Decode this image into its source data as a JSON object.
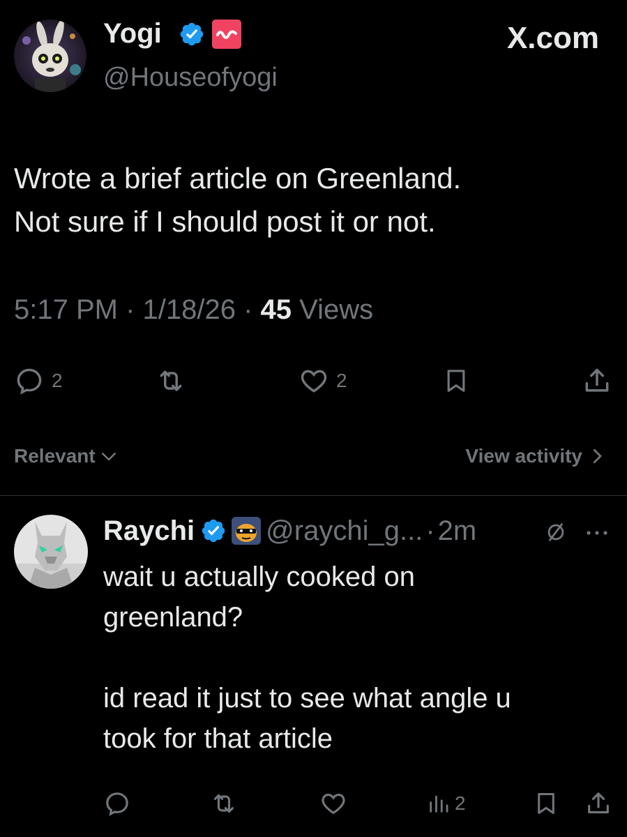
{
  "post": {
    "author_name": "Yogi",
    "author_handle": "@Houseofyogi",
    "site": "X.com",
    "text": "Wrote a brief article on Greenland.\nNot sure if I should post it or not.",
    "time": "5:17 PM · 1/18/26 ·",
    "views_count": "45",
    "views_label": "Views",
    "replies": "2",
    "likes": "2"
  },
  "sort": {
    "label": "Relevant",
    "view_activity": "View activity"
  },
  "reply": {
    "author_name": "Raychi",
    "author_handle": "@raychi_g...",
    "separator": "·",
    "time": "2m",
    "text": "wait u actually cooked on\ngreenland?\n\nid read it just to see what angle u\ntook for that article",
    "views": "2"
  },
  "colors": {
    "background": "#000000",
    "text": "#e7e9ea",
    "muted": "#71767b",
    "verified": "#1d9bf0",
    "badge_pink": "#ef4361"
  },
  "icons": [
    "reply-icon",
    "retweet-icon",
    "like-icon",
    "bookmark-icon",
    "share-icon",
    "analytics-icon",
    "chevron-down-icon",
    "chevron-right-icon",
    "verified-icon",
    "no-sign-icon",
    "more-icon"
  ]
}
